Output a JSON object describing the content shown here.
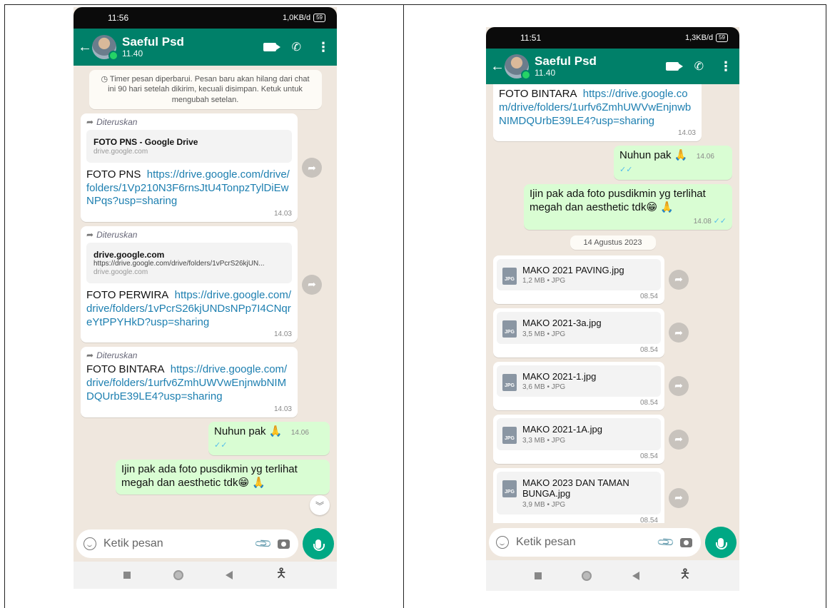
{
  "left": {
    "status": {
      "time": "11:56",
      "right": "1,0KB/d",
      "battery": "59"
    },
    "header": {
      "name": "Saeful Psd",
      "sub": "11.40"
    },
    "system_notice": "Timer pesan diperbarui. Pesan baru akan hilang dari chat ini 90 hari setelah dikirim, kecuali disimpan. Ketuk untuk mengubah setelan.",
    "messages": [
      {
        "forwarded": "Diteruskan",
        "preview_title": "FOTO PNS - Google Drive",
        "preview_desc": "",
        "preview_domain": "drive.google.com",
        "label": "FOTO PNS",
        "link": "https://drive.google.com/drive/folders/1Vp210N3F6rnsJtU4TonpzTylDiEwNPqs?usp=sharing",
        "time": "14.03"
      },
      {
        "forwarded": "Diteruskan",
        "preview_title": "drive.google.com",
        "preview_desc": "https://drive.google.com/drive/folders/1vPcrS26kjUN...",
        "preview_domain": "drive.google.com",
        "label": "FOTO PERWIRA",
        "link": "https://drive.google.com/drive/folders/1vPcrS26kjUNDsNPp7I4CNqreYtPPYHkD?usp=sharing",
        "time": "14.03"
      },
      {
        "forwarded": "Diteruskan",
        "label": "FOTO BINTARA",
        "link": "https://drive.google.com/drive/folders/1urfv6ZmhUWVwEnjnwbNIMDQUrbE39LE4?usp=sharing",
        "time": "14.03"
      }
    ],
    "out1": {
      "text": "Nuhun pak 🙏",
      "time": "14.06",
      "ticks": "✓✓"
    },
    "out2": {
      "text": "Ijin pak ada foto pusdikmin yg terlihat megah dan aesthetic tdk😁 🙏"
    },
    "input_placeholder": "Ketik pesan"
  },
  "right": {
    "status": {
      "time": "11:51",
      "right": "1,3KB/d",
      "battery": "59"
    },
    "header": {
      "name": "Saeful Psd",
      "sub": "11.40"
    },
    "top_msg": {
      "label": "FOTO BINTARA",
      "link": "https://drive.google.com/drive/folders/1urfv6ZmhUWVwEnjnwbNIMDQUrbE39LE4?usp=sharing",
      "time": "14.03"
    },
    "out1": {
      "text": "Nuhun pak 🙏",
      "time": "14.06",
      "ticks": "✓✓"
    },
    "out2": {
      "text": "Ijin pak ada foto pusdikmin yg terlihat megah dan aesthetic tdk😁 🙏",
      "time": "14.08",
      "ticks": "✓✓"
    },
    "date_pill": "14 Agustus 2023",
    "docs": [
      {
        "name": "MAKO 2021 PAVING.jpg",
        "meta": "1,2 MB • JPG",
        "time": "08.54"
      },
      {
        "name": "MAKO 2021-3a.jpg",
        "meta": "3,5 MB • JPG",
        "time": "08.54"
      },
      {
        "name": "MAKO 2021-1.jpg",
        "meta": "3,6 MB • JPG",
        "time": "08.54"
      },
      {
        "name": "MAKO 2021-1A.jpg",
        "meta": "3,3 MB • JPG",
        "time": "08.54"
      },
      {
        "name": "MAKO 2023 DAN TAMAN BUNGA.jpg",
        "meta": "3,9 MB • JPG",
        "time": "08.54"
      }
    ],
    "input_placeholder": "Ketik pesan"
  },
  "jpg_label": "JPG"
}
